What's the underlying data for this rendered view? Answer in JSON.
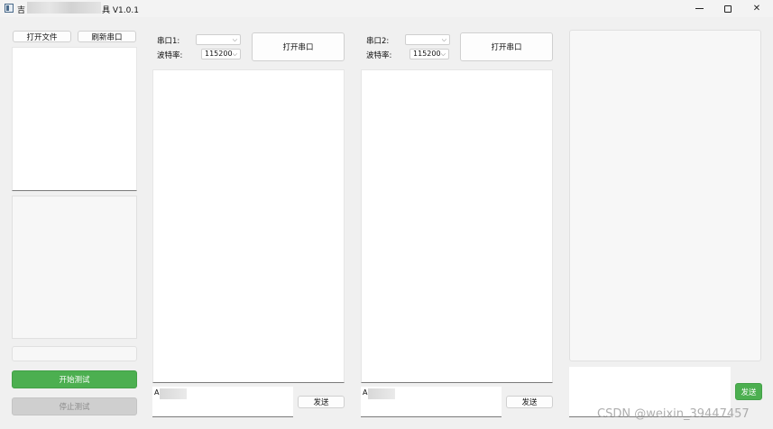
{
  "window": {
    "title_prefix": "吉",
    "title_suffix": "具 V1.0.1",
    "minimize_icon": "minimize-icon",
    "maximize_icon": "maximize-icon",
    "close_icon": "close-icon",
    "close_glyph": "✕"
  },
  "left": {
    "open_file_label": "打开文件",
    "refresh_ports_label": "刷新串口",
    "start_test_label": "开始测试",
    "stop_test_label": "停止测试"
  },
  "port1": {
    "port_label": "串口1:",
    "port_value": "",
    "baud_label": "波特率:",
    "baud_value": "115200",
    "open_label": "打开串口",
    "input_prefix": "A",
    "send_label": "发送"
  },
  "port2": {
    "port_label": "串口2:",
    "port_value": "",
    "baud_label": "波特率:",
    "baud_value": "115200",
    "open_label": "打开串口",
    "input_prefix": "A",
    "send_label": "发送"
  },
  "right": {
    "send_label": "发送"
  },
  "watermark": "CSDN @weixin_39447457",
  "colors": {
    "accent_green": "#4caf50",
    "disabled_grey": "#cfcfcf"
  }
}
